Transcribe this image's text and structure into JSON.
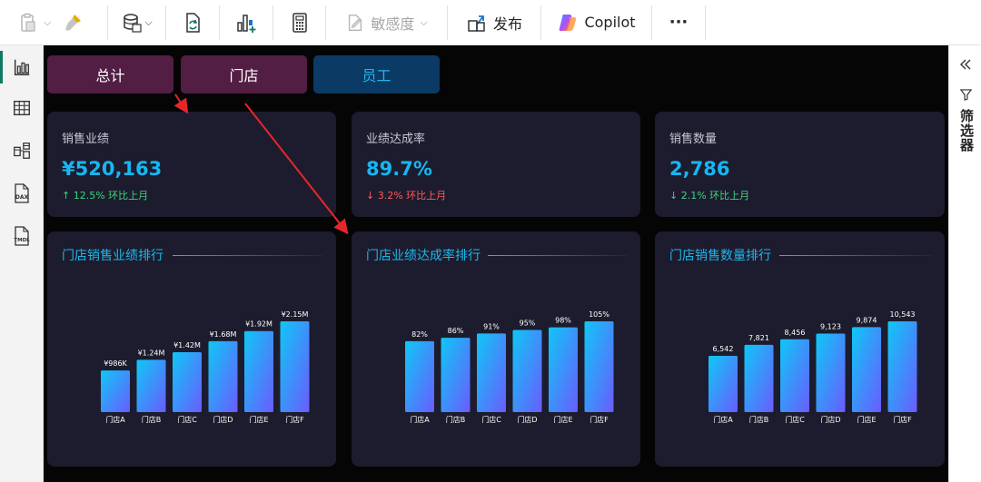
{
  "toolbar": {
    "sensitivity_label": "敏感度",
    "publish_label": "发布",
    "copilot_label": "Copilot",
    "more_label": "···"
  },
  "rail": {
    "items": [
      "report-view",
      "table-view",
      "model-view",
      "dax-query-view",
      "tmdl-view"
    ],
    "dax_label": "DAX",
    "tmdl_label": "TMDL"
  },
  "tabs": [
    {
      "label": "总计",
      "color": "#521e43"
    },
    {
      "label": "门店",
      "color": "#521e43"
    },
    {
      "label": "员工",
      "color": "#0b3a64"
    }
  ],
  "kpis": [
    {
      "title": "销售业绩",
      "value": "¥520,163",
      "delta": "↑ 12.5% 环比上月",
      "trend": "up"
    },
    {
      "title": "业绩达成率",
      "value": "89.7%",
      "delta": "↓ 3.2% 环比上月",
      "trend": "down"
    },
    {
      "title": "销售数量",
      "value": "2,786",
      "delta": "↓ 2.1% 环比上月",
      "trend": "up"
    }
  ],
  "chart_data": [
    {
      "type": "bar",
      "title": "门店销售业绩排行",
      "categories": [
        "门店A",
        "门店B",
        "门店C",
        "门店D",
        "门店E",
        "门店F"
      ],
      "values": [
        986000,
        1240000,
        1420000,
        1680000,
        1920000,
        2150000
      ],
      "labels": [
        "¥986K",
        "¥1.24M",
        "¥1.42M",
        "¥1.68M",
        "¥1.92M",
        "¥2.15M"
      ],
      "ylim": [
        0,
        2150000
      ]
    },
    {
      "type": "bar",
      "title": "门店业绩达成率排行",
      "categories": [
        "门店A",
        "门店B",
        "门店C",
        "门店D",
        "门店E",
        "门店F"
      ],
      "values": [
        82,
        86,
        91,
        95,
        98,
        105
      ],
      "labels": [
        "82%",
        "86%",
        "91%",
        "95%",
        "98%",
        "105%"
      ],
      "ylim": [
        0,
        105
      ]
    },
    {
      "type": "bar",
      "title": "门店销售数量排行",
      "categories": [
        "门店A",
        "门店B",
        "门店C",
        "门店D",
        "门店E",
        "门店F"
      ],
      "values": [
        6542,
        7821,
        8456,
        9123,
        9874,
        10543
      ],
      "labels": [
        "6,542",
        "7,821",
        "8,456",
        "9,123",
        "9,874",
        "10,543"
      ],
      "ylim": [
        0,
        10543
      ]
    }
  ],
  "filter_pane": {
    "label": "筛选器"
  },
  "colors": {
    "accent": "#1fb6ea",
    "bar_top": "#0fc7f5",
    "bar_bottom": "#6a5cff",
    "annotation": "#e8262a"
  }
}
